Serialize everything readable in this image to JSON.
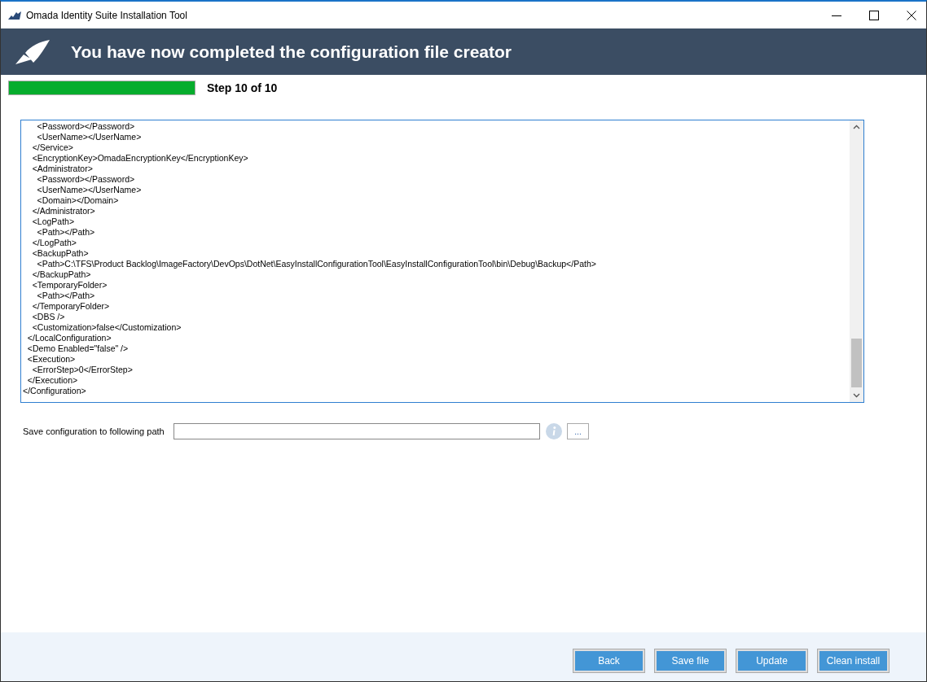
{
  "window": {
    "title": "Omada Identity Suite Installation Tool"
  },
  "header": {
    "title": "You have now completed the configuration file creator"
  },
  "progress": {
    "level": 1,
    "label": "Step 10 of 10"
  },
  "editor": {
    "lines": [
      "      <Password></Password>",
      "      <UserName></UserName>",
      "    </Service>",
      "    <EncryptionKey>OmadaEncryptionKey</EncryptionKey>",
      "    <Administrator>",
      "      <Password></Password>",
      "      <UserName></UserName>",
      "      <Domain></Domain>",
      "    </Administrator>",
      "    <LogPath>",
      "      <Path></Path>",
      "    </LogPath>",
      "    <BackupPath>",
      "      <Path>C:\\TFS\\Product Backlog\\ImageFactory\\DevOps\\DotNet\\EasyInstallConfigurationTool\\EasyInstallConfigurationTool\\bin\\Debug\\Backup</Path>",
      "    </BackupPath>",
      "    <TemporaryFolder>",
      "      <Path></Path>",
      "    </TemporaryFolder>",
      "    <DBS />",
      "    <Customization>false</Customization>",
      "  </LocalConfiguration>",
      "  <Demo Enabled=\"false\" />",
      "  <Execution>",
      "    <ErrorStep>0</ErrorStep>",
      "  </Execution>",
      "</Configuration>"
    ]
  },
  "save_path": {
    "label": "Save configuration to following path",
    "browse": "..."
  },
  "buttons": [
    "Back",
    "Save file",
    "Update",
    "Clean install"
  ]
}
